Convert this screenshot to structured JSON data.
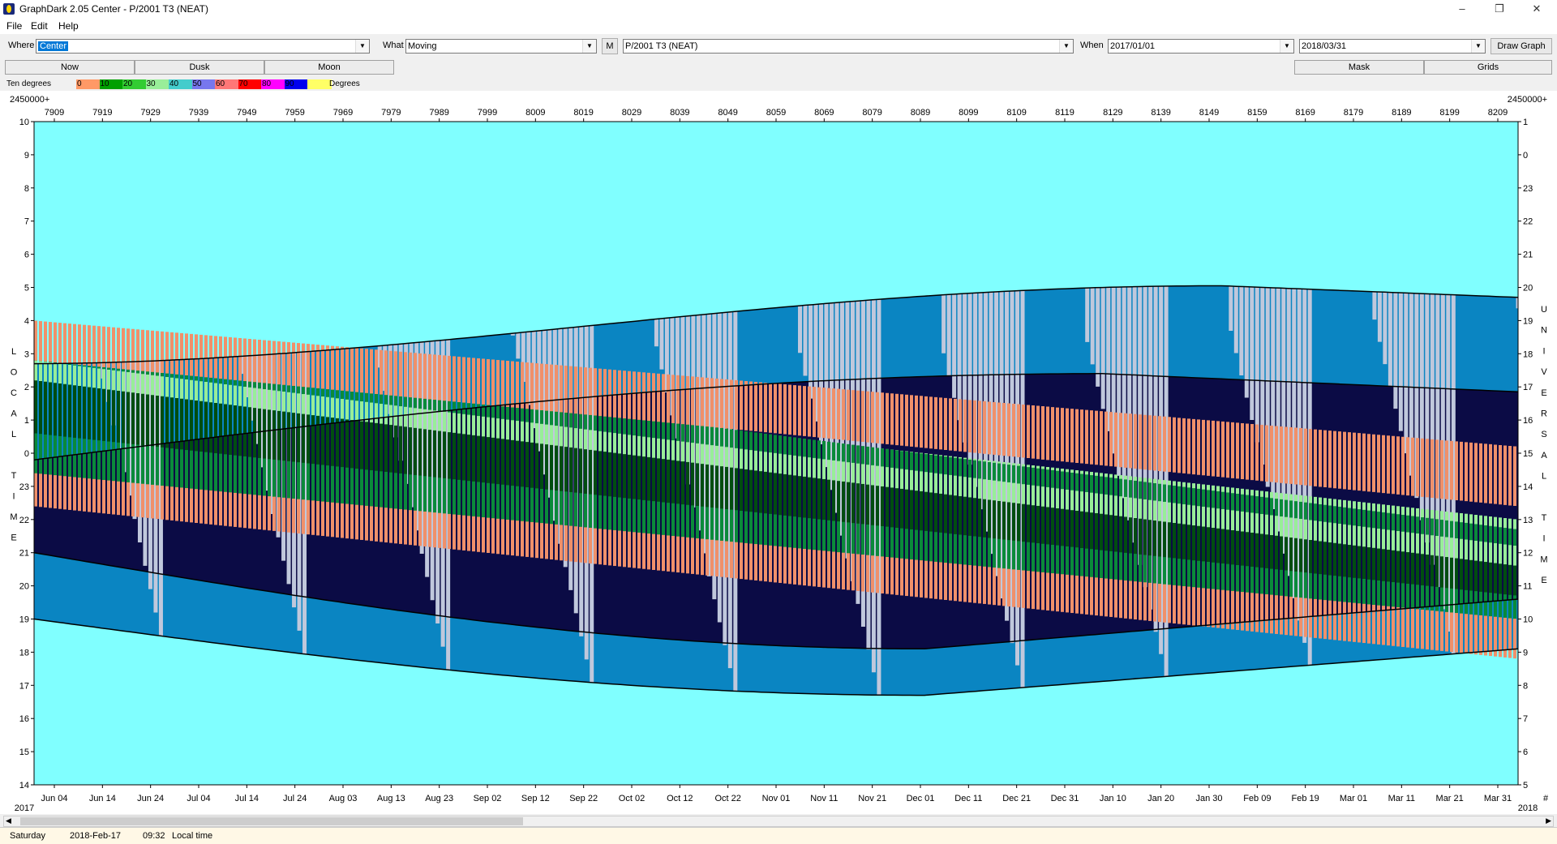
{
  "window": {
    "title": "GraphDark 2.05  Center  -  P/2001 T3 (NEAT)",
    "minimize": "–",
    "maximize": "❐",
    "close": "✕"
  },
  "menu": {
    "file": "File",
    "edit": "Edit",
    "help": "Help"
  },
  "toolbar": {
    "where_label": "Where",
    "where_value": "Center",
    "what_label": "What",
    "what_value": "Moving",
    "m_button": "M",
    "object_value": "P/2001 T3 (NEAT)",
    "when_label": "When",
    "when_start": "2017/01/01",
    "when_end": "2018/03/31",
    "draw_button": "Draw Graph"
  },
  "buttons": {
    "now": "Now",
    "dusk": "Dusk",
    "moon": "Moon",
    "mask": "Mask",
    "grids": "Grids"
  },
  "legend": {
    "left_label": "Ten degrees",
    "right_label": "Degrees",
    "swatches": [
      {
        "label": "0",
        "color": "#ff9966"
      },
      {
        "label": "10",
        "color": "#00a000"
      },
      {
        "label": "20",
        "color": "#33cc33"
      },
      {
        "label": "30",
        "color": "#99ee99"
      },
      {
        "label": "40",
        "color": "#44cccc"
      },
      {
        "label": "50",
        "color": "#7777ee"
      },
      {
        "label": "60",
        "color": "#ff7777"
      },
      {
        "label": "70",
        "color": "#ff0000"
      },
      {
        "label": "80",
        "color": "#ff00ff"
      },
      {
        "label": "90",
        "color": "#0000ee"
      },
      {
        "label": "",
        "color": "#ffff66"
      }
    ]
  },
  "chart": {
    "jd_prefix_left": "2450000+",
    "jd_prefix_right": "2450000+",
    "jd_ticks": [
      "7909",
      "7919",
      "7929",
      "7939",
      "7949",
      "7959",
      "7969",
      "7979",
      "7989",
      "7999",
      "8009",
      "8019",
      "8029",
      "8039",
      "8049",
      "8059",
      "8069",
      "8079",
      "8089",
      "8099",
      "8109",
      "8119",
      "8129",
      "8139",
      "8149",
      "8159",
      "8169",
      "8179",
      "8189",
      "8199",
      "8209"
    ],
    "date_ticks": [
      "Jun 04",
      "Jun 14",
      "Jun 24",
      "Jul 04",
      "Jul 14",
      "Jul 24",
      "Aug 03",
      "Aug 13",
      "Aug 23",
      "Sep 02",
      "Sep 12",
      "Sep 22",
      "Oct 02",
      "Oct 12",
      "Oct 22",
      "Nov 01",
      "Nov 11",
      "Nov 21",
      "Dec 01",
      "Dec 11",
      "Dec 21",
      "Dec 31",
      "Jan 10",
      "Jan 20",
      "Jan 30",
      "Feb 09",
      "Feb 19",
      "Mar 01",
      "Mar 11",
      "Mar 21",
      "Mar 31"
    ],
    "year_left": "2017",
    "year_right": "2018",
    "corner_right": "#",
    "left_ticks": [
      "10",
      "9",
      "8",
      "7",
      "6",
      "5",
      "4",
      "3",
      "2",
      "1",
      "0",
      "23",
      "22",
      "21",
      "20",
      "19",
      "18",
      "17",
      "16",
      "15",
      "14"
    ],
    "right_ticks": [
      "1",
      "0",
      "23",
      "22",
      "21",
      "20",
      "19",
      "18",
      "17",
      "16",
      "15",
      "14",
      "13",
      "12",
      "11",
      "10",
      "9",
      "8",
      "7",
      "6",
      "5"
    ],
    "left_axis_letters": [
      "L",
      "O",
      "C",
      "A",
      "L",
      "",
      "T",
      "I",
      "M",
      "E"
    ],
    "right_axis_letters": [
      "U",
      "N",
      "I",
      "V",
      "E",
      "R",
      "S",
      "A",
      "L",
      "",
      "T",
      "I",
      "M",
      "E"
    ],
    "colors": {
      "daylight": "#80ffff",
      "night": "#0b0b45",
      "twilight": "#0a85c2",
      "moonlit": "#c0c8dc",
      "alt_low": "#f0906a",
      "alt_mid": "#0a8a3a",
      "alt_high": "#98ee98",
      "alt_top": "#004d10"
    }
  },
  "status": {
    "day": "Saturday",
    "date": "2018-Feb-17",
    "time": "09:32",
    "time_label": "Local time"
  }
}
